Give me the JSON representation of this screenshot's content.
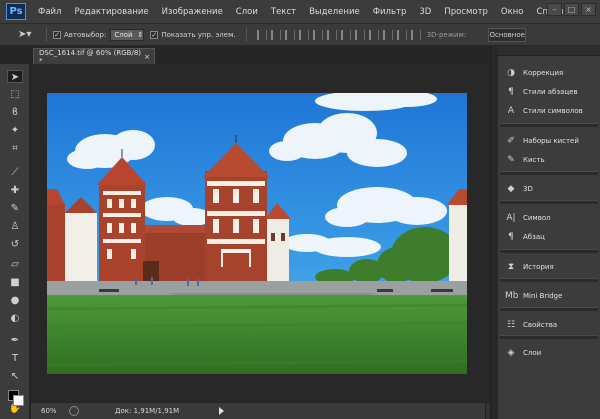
{
  "app": {
    "logo": "Ps"
  },
  "menu": [
    "Файл",
    "Редактирование",
    "Изображение",
    "Слои",
    "Текст",
    "Выделение",
    "Фильтр",
    "3D",
    "Просмотр",
    "Окно",
    "Справка"
  ],
  "window_buttons": {
    "minimize": "–",
    "maximize": "□",
    "close": "×"
  },
  "options_bar": {
    "autoselect_label": "Автовыбор:",
    "autoselect_value": "Слой",
    "show_controls_label": "Показать упр. элем.",
    "mode_3d_label": "3D-режим:",
    "workspace_label": "Основное"
  },
  "document": {
    "tab_title": "DSC_1614.tif @ 60% (RGB/8) *",
    "close_glyph": "×"
  },
  "status": {
    "zoom": "60%",
    "doc_info": "Док: 1,91M/1,91M"
  },
  "toolbar": {
    "tools": [
      {
        "name": "move-tool",
        "glyph": "➤"
      },
      {
        "name": "marquee-tool",
        "glyph": "⬚"
      },
      {
        "name": "lasso-tool",
        "glyph": "ϐ"
      },
      {
        "name": "magic-wand-tool",
        "glyph": "✦"
      },
      {
        "name": "crop-tool",
        "glyph": "⌗"
      },
      {
        "name": "eyedropper-tool",
        "glyph": "⟋"
      },
      {
        "name": "healing-brush-tool",
        "glyph": "✚"
      },
      {
        "name": "brush-tool",
        "glyph": "✎"
      },
      {
        "name": "clone-stamp-tool",
        "glyph": "♙"
      },
      {
        "name": "history-brush-tool",
        "glyph": "↺"
      },
      {
        "name": "eraser-tool",
        "glyph": "▱"
      },
      {
        "name": "gradient-tool",
        "glyph": "■"
      },
      {
        "name": "blur-tool",
        "glyph": "●"
      },
      {
        "name": "dodge-tool",
        "glyph": "◐"
      },
      {
        "name": "pen-tool",
        "glyph": "✒"
      },
      {
        "name": "type-tool",
        "glyph": "T"
      },
      {
        "name": "path-selection-tool",
        "glyph": "↖"
      },
      {
        "name": "shape-tool",
        "glyph": "▭"
      },
      {
        "name": "hand-tool",
        "glyph": "✋"
      },
      {
        "name": "zoom-tool",
        "glyph": "⚲"
      }
    ]
  },
  "panels": [
    {
      "icon": "correction-icon",
      "glyph": "◑",
      "label": "Коррекция"
    },
    {
      "icon": "paragraph-styles-icon",
      "glyph": "¶",
      "label": "Стили абзацев"
    },
    {
      "icon": "character-styles-icon",
      "glyph": "A",
      "label": "Стили символов"
    },
    {
      "icon": "brush-presets-icon",
      "glyph": "✐",
      "label": "Наборы кистей"
    },
    {
      "icon": "brush-icon",
      "glyph": "✎",
      "label": "Кисть"
    },
    {
      "icon": "3d-icon",
      "glyph": "◆",
      "label": "3D"
    },
    {
      "icon": "character-icon",
      "glyph": "A|",
      "label": "Символ"
    },
    {
      "icon": "paragraph-icon",
      "glyph": "¶",
      "label": "Абзац"
    },
    {
      "icon": "history-icon",
      "glyph": "⧗",
      "label": "История"
    },
    {
      "icon": "mini-bridge-icon",
      "glyph": "Mb",
      "label": "Mini Bridge"
    },
    {
      "icon": "properties-icon",
      "glyph": "☷",
      "label": "Свойства"
    },
    {
      "icon": "layers-icon",
      "glyph": "◈",
      "label": "Слои"
    }
  ],
  "colors": {
    "sky": "#2f8ee0",
    "grass": "#4f9a3a",
    "brick": "#a8422c",
    "roof": "#b8452e"
  }
}
